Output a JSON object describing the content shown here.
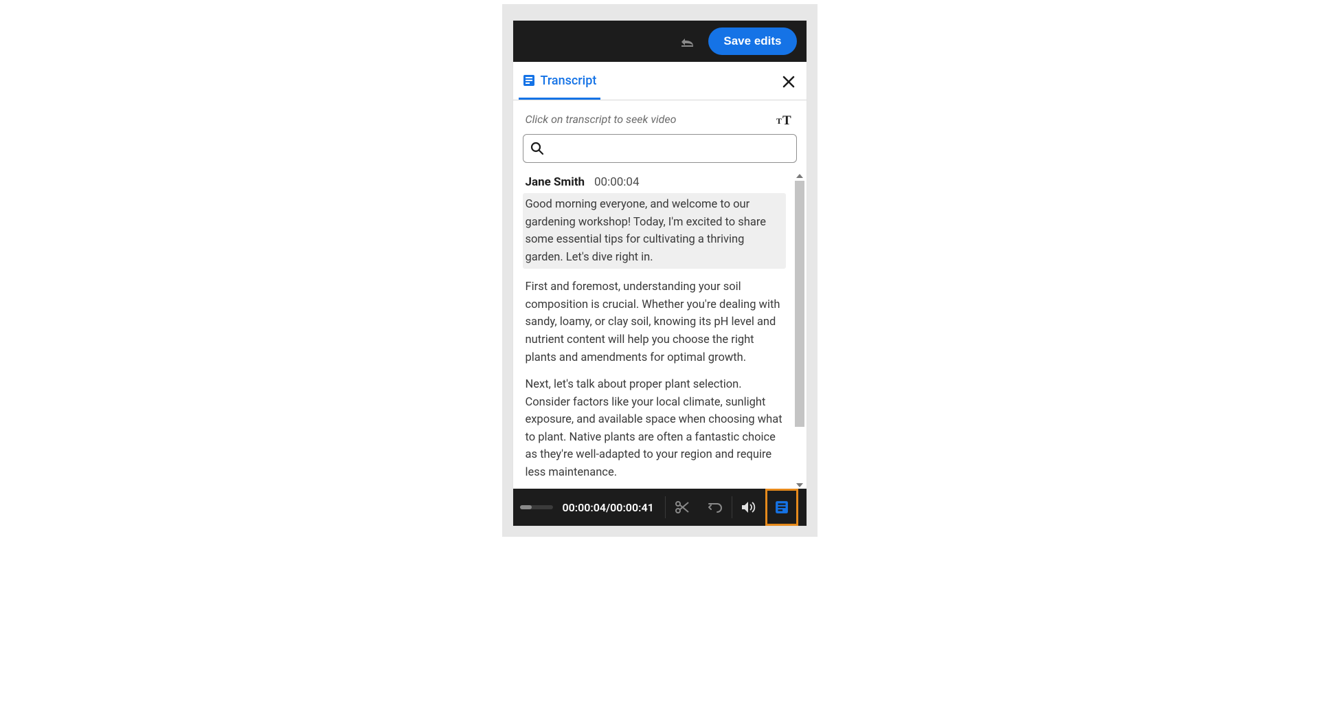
{
  "toolbar": {
    "save_label": "Save edits"
  },
  "tab": {
    "label": "Transcript"
  },
  "hint": "Click on transcript to seek video",
  "search": {
    "placeholder": ""
  },
  "transcript": {
    "speaker": "Jane Smith",
    "timestamp": "00:00:04",
    "paragraphs": [
      "Good morning everyone, and welcome to our gardening workshop! Today, I'm excited to share some essential tips for cultivating a thriving garden. Let's dive right in.",
      "First and foremost, understanding your soil composition is crucial. Whether you're dealing with sandy, loamy, or clay soil, knowing its pH level and nutrient content will help you choose the right plants and amendments for optimal growth.",
      "Next, let's talk about proper plant selection. Consider factors like your local climate, sunlight exposure, and available space when choosing what to plant. Native plants are often a fantastic choice as they're well-adapted to your region and require less maintenance."
    ]
  },
  "controlbar": {
    "current_time": "00:00:04",
    "total_time": "00:00:41"
  }
}
